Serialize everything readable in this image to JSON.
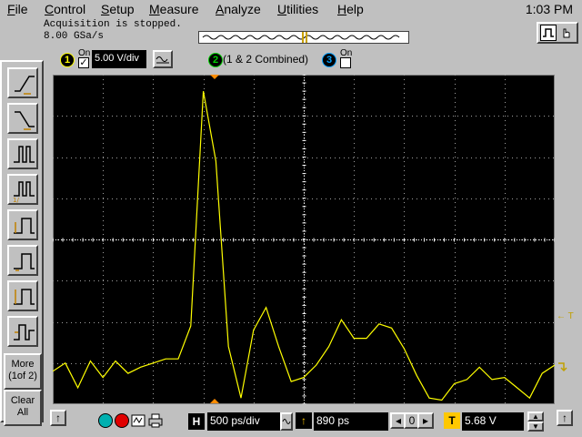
{
  "menu": {
    "items": [
      "File",
      "Control",
      "Setup",
      "Measure",
      "Analyze",
      "Utilities",
      "Help"
    ],
    "clock": "1:03 PM"
  },
  "status": {
    "line1": "Acquisition is stopped.",
    "line2": "8.00 GSa/s"
  },
  "channels": {
    "ch1": {
      "number": "1",
      "on_label": "On",
      "checked": true,
      "scale": "5.00 V/div",
      "color": "#ffff00"
    },
    "ch2": {
      "number": "2",
      "label": "(1 & 2 Combined)",
      "color": "#00c000"
    },
    "ch3": {
      "number": "3",
      "on_label": "On",
      "checked": false,
      "color": "#00a0ff"
    }
  },
  "side": {
    "more_label": "More\n(1of 2)",
    "more_line1": "More",
    "more_line2": "(1of 2)",
    "clear_line1": "Clear",
    "clear_line2": "All"
  },
  "toolbar_icons": [
    "rising-edge-icon",
    "falling-edge-icon",
    "pulse-width-icon",
    "pulse-width-1of-icon",
    "glitch-icon",
    "runt-icon",
    "timeout-icon",
    "transition-icon"
  ],
  "markers": {
    "trigger_level": "← T"
  },
  "bottom": {
    "h_label": "H",
    "timebase": "500 ps/div",
    "delay": "890 ps",
    "t_label": "T",
    "trigger_level": "5.68 V",
    "zero": "0"
  },
  "waveform": {
    "color": "#ffff00",
    "samples": [
      -3.2,
      -3.0,
      -3.6,
      -2.95,
      -3.35,
      -2.95,
      -3.25,
      -3.1,
      -3.0,
      -2.9,
      -2.9,
      -2.1,
      3.6,
      1.9,
      -2.6,
      -3.85,
      -2.2,
      -1.65,
      -2.6,
      -3.45,
      -3.35,
      -3.05,
      -2.6,
      -1.95,
      -2.4,
      -2.4,
      -2.05,
      -2.15,
      -2.65,
      -3.3,
      -3.85,
      -3.9,
      -3.5,
      -3.4,
      -3.1,
      -3.4,
      -3.35,
      -3.6,
      -3.85,
      -3.25,
      -3.05
    ]
  }
}
